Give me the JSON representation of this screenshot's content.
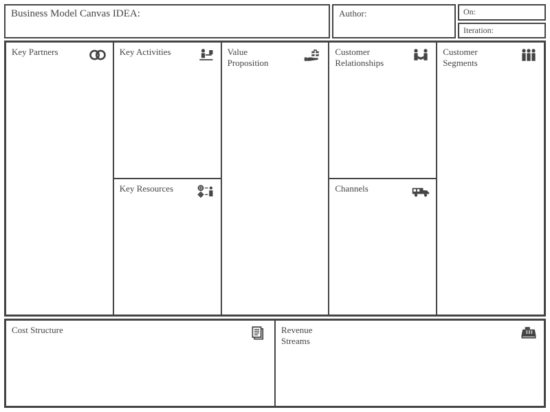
{
  "header": {
    "title_label": "Business Model Canvas IDEA:",
    "author_label": "Author:",
    "on_label": "On:",
    "iteration_label": "Iteration:"
  },
  "cells": {
    "key_partners": "Key Partners",
    "key_activities": "Key Activities",
    "key_resources": "Key Resources",
    "value_proposition": "Value Proposition",
    "customer_relationships": "Customer Relationships",
    "channels": "Channels",
    "customer_segments": "Customer Segments",
    "cost_structure": "Cost Structure",
    "revenue_streams": "Revenue Streams"
  }
}
